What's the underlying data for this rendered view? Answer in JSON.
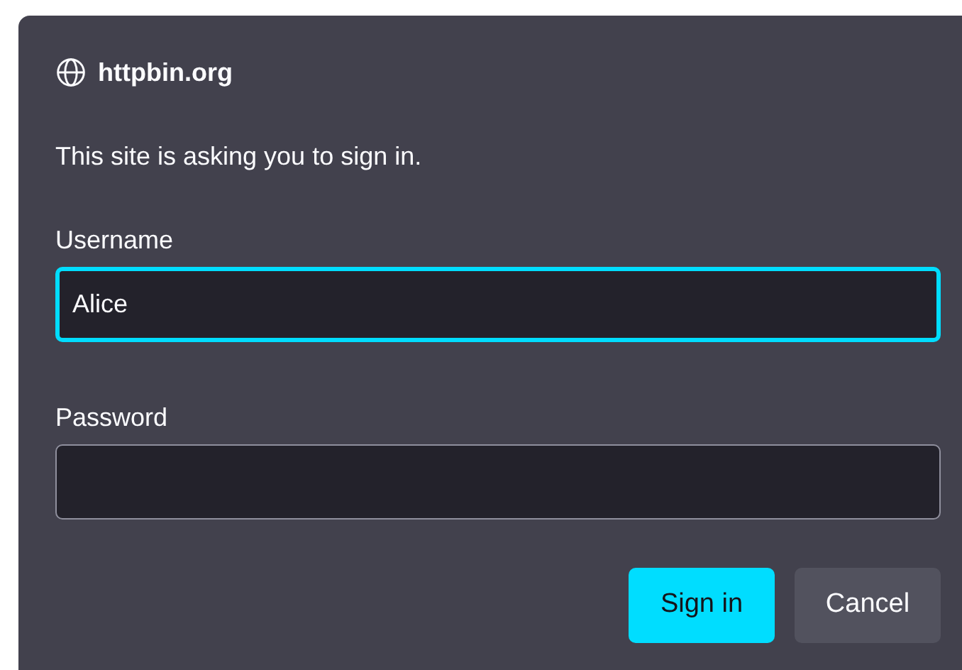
{
  "dialog": {
    "site": "httpbin.org",
    "message": "This site is asking you to sign in.",
    "fields": [
      {
        "label": "Username",
        "value": "Alice",
        "focused": true
      },
      {
        "label": "Password",
        "focused": false
      }
    ],
    "buttons": [
      {
        "label": "Sign in",
        "kind": "primary"
      },
      {
        "label": "Cancel",
        "kind": "secondary"
      }
    ]
  }
}
